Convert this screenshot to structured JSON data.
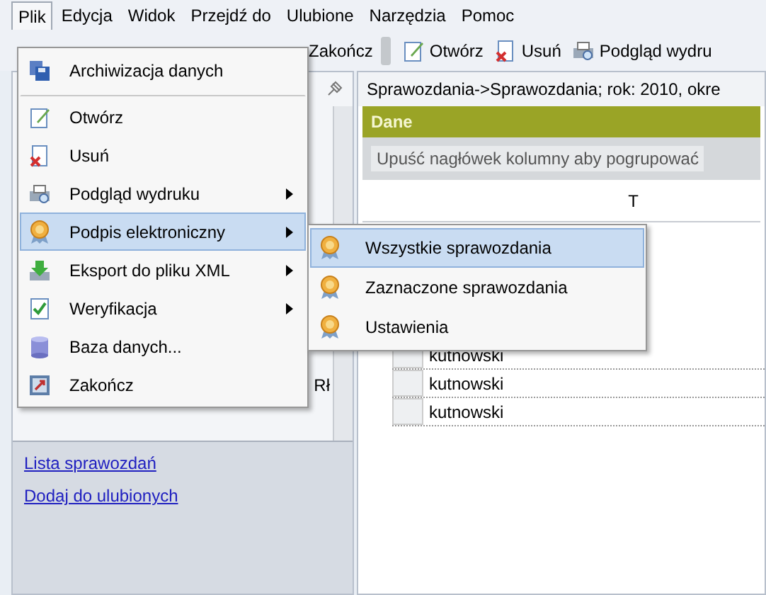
{
  "menubar": [
    {
      "label": "Plik",
      "selected": true
    },
    {
      "label": "Edycja",
      "selected": false
    },
    {
      "label": "Widok",
      "selected": false
    },
    {
      "label": "Przejdź do",
      "selected": false
    },
    {
      "label": "Ulubione",
      "selected": false
    },
    {
      "label": "Narzędzia",
      "selected": false
    },
    {
      "label": "Pomoc",
      "selected": false
    }
  ],
  "toolbar": [
    {
      "label": "Zakończ",
      "kind": "text"
    },
    {
      "label": "Otwórz",
      "kind": "open"
    },
    {
      "label": "Usuń",
      "kind": "delete"
    },
    {
      "label": "Podgląd wydru",
      "kind": "preview"
    }
  ],
  "file_menu": [
    {
      "label": "Archiwizacja danych",
      "kind": "archive",
      "submenu": false,
      "selected": false,
      "separator_after": true
    },
    {
      "label": "Otwórz",
      "kind": "open",
      "submenu": false,
      "selected": false,
      "separator_after": false
    },
    {
      "label": "Usuń",
      "kind": "delete",
      "submenu": false,
      "selected": false,
      "separator_after": false
    },
    {
      "label": "Podgląd wydruku",
      "kind": "preview",
      "submenu": true,
      "selected": false,
      "separator_after": false
    },
    {
      "label": "Podpis elektroniczny",
      "kind": "seal",
      "submenu": true,
      "selected": true,
      "separator_after": false
    },
    {
      "label": "Eksport do pliku XML",
      "kind": "export",
      "submenu": true,
      "selected": false,
      "separator_after": false
    },
    {
      "label": "Weryfikacja",
      "kind": "check",
      "submenu": true,
      "selected": false,
      "separator_after": false
    },
    {
      "label": "Baza danych...",
      "kind": "database",
      "submenu": false,
      "selected": false,
      "separator_after": false
    },
    {
      "label": "Zakończ",
      "kind": "exit",
      "submenu": false,
      "selected": false,
      "separator_after": false
    }
  ],
  "submenu": [
    {
      "label": "Wszystkie sprawozdania",
      "selected": true
    },
    {
      "label": "Zaznaczone sprawozdania",
      "selected": false
    },
    {
      "label": "Ustawienia",
      "selected": false
    }
  ],
  "left_panel": {
    "fragment": "Rł",
    "links": [
      "Lista sprawozdań",
      "Dodaj do ulubionych"
    ]
  },
  "content": {
    "breadcrumb": "Sprawozdania->Sprawozdania; rok: 2010, okre",
    "section_title": "Dane",
    "group_hint": "Upuść nagłówek kolumny aby pogrupować",
    "column_header": "T",
    "rows": [
      "kutnowski",
      "kutnowski",
      "kutnowski"
    ]
  }
}
